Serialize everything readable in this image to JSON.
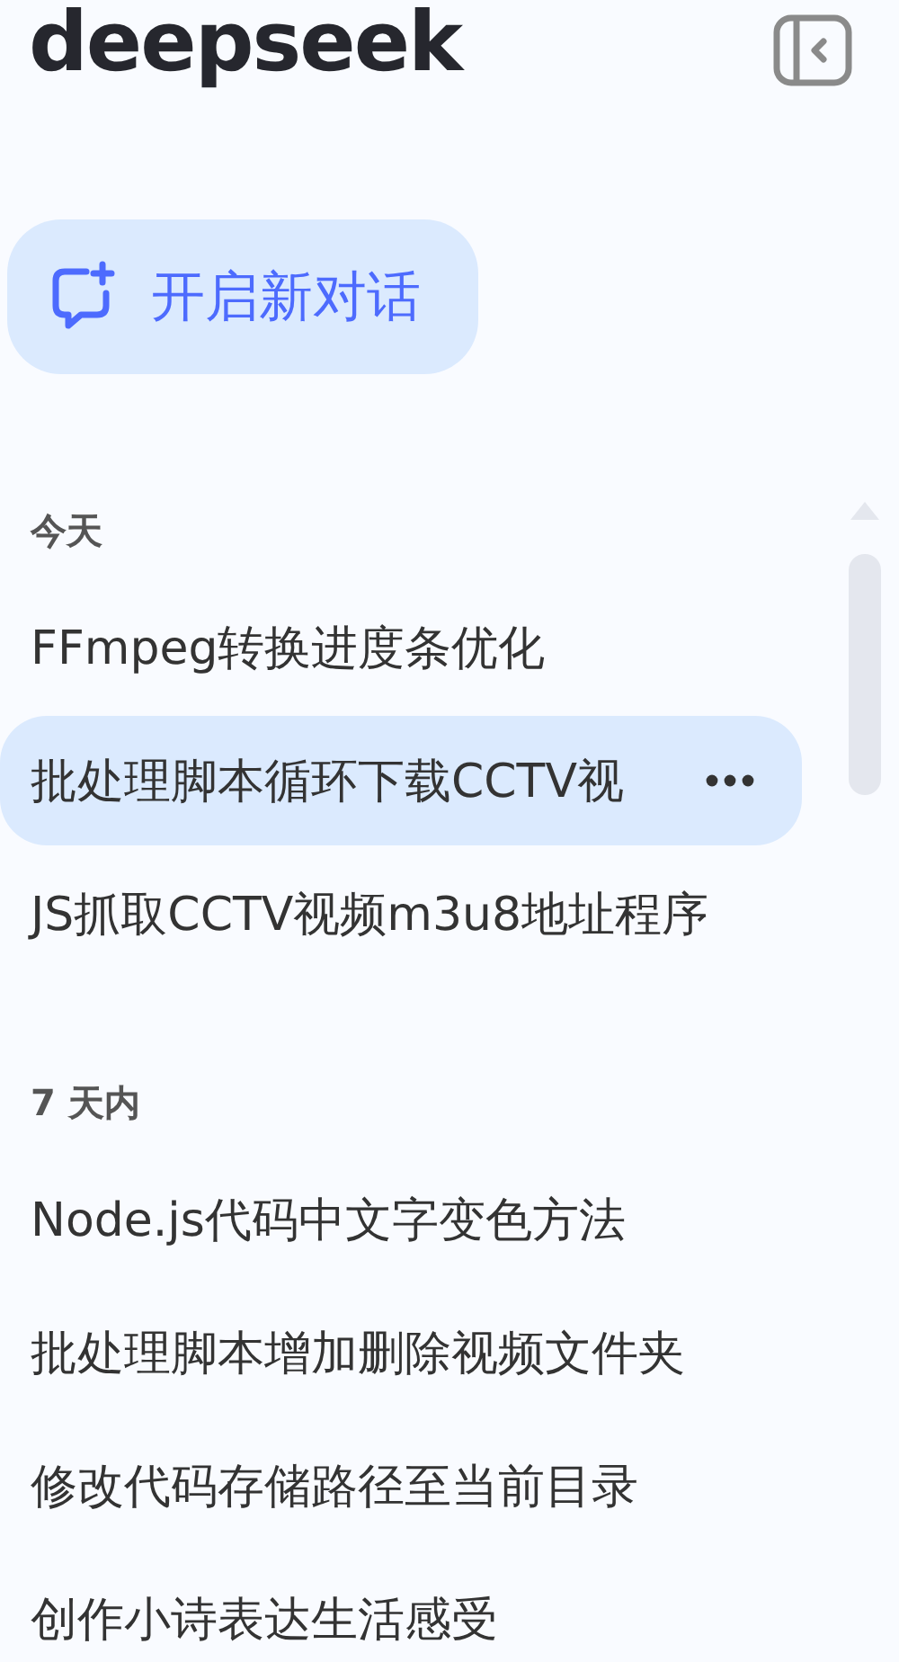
{
  "logo": "deepseek",
  "new_chat": {
    "label": "开启新对话"
  },
  "sections": [
    {
      "title": "今天",
      "items": [
        {
          "title": "FFmpeg转换进度条优化",
          "selected": false
        },
        {
          "title": "批处理脚本循环下载CCTV视",
          "selected": true
        },
        {
          "title": "JS抓取CCTV视频m3u8地址程序",
          "selected": false
        }
      ]
    },
    {
      "title": "7 天内",
      "items": [
        {
          "title": "Node.js代码中文字变色方法",
          "selected": false
        },
        {
          "title": "批处理脚本增加删除视频文件夹",
          "selected": false
        },
        {
          "title": "修改代码存储路径至当前目录",
          "selected": false
        },
        {
          "title": "创作小诗表达生活感受",
          "selected": false
        }
      ]
    }
  ]
}
